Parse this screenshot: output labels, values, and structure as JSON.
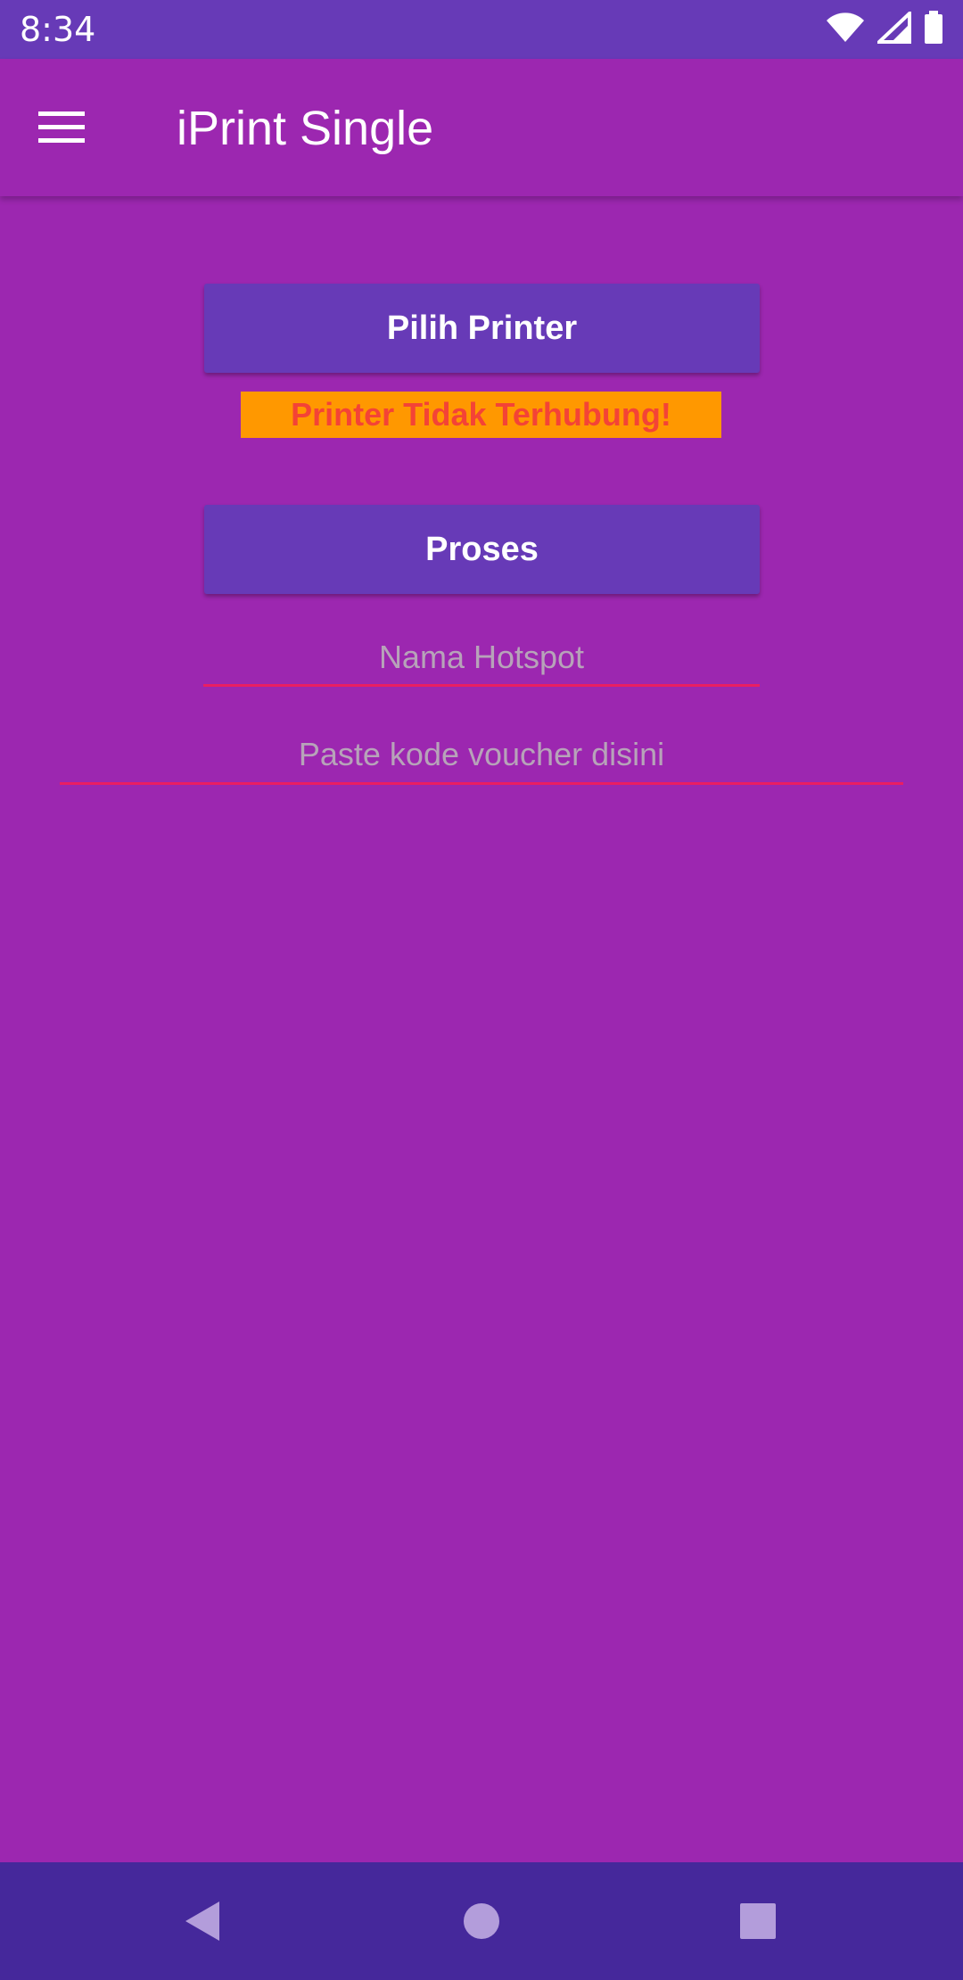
{
  "status_bar": {
    "time": "8:34",
    "icons": [
      "wifi-icon",
      "signal-icon",
      "battery-icon"
    ]
  },
  "app_bar": {
    "title": "iPrint Single",
    "menu_icon": "hamburger-menu-icon"
  },
  "main": {
    "select_printer_label": "Pilih Printer",
    "printer_status_text": "Printer Tidak Terhubung!",
    "process_label": "Proses",
    "hotspot_placeholder": "Nama Hotspot",
    "hotspot_value": "",
    "voucher_placeholder": "Paste kode voucher disini",
    "voucher_value": ""
  },
  "nav_bar": {
    "icons": [
      "back-icon",
      "home-icon",
      "recents-icon"
    ]
  },
  "colors": {
    "primary": "#9c27b0",
    "primary_dark": "#673ab7",
    "button": "#673ab7",
    "status_label_bg": "#ff9800",
    "status_label_text": "#f44336",
    "field_underline": "#e91e63",
    "nav_bar": "#45289b"
  }
}
